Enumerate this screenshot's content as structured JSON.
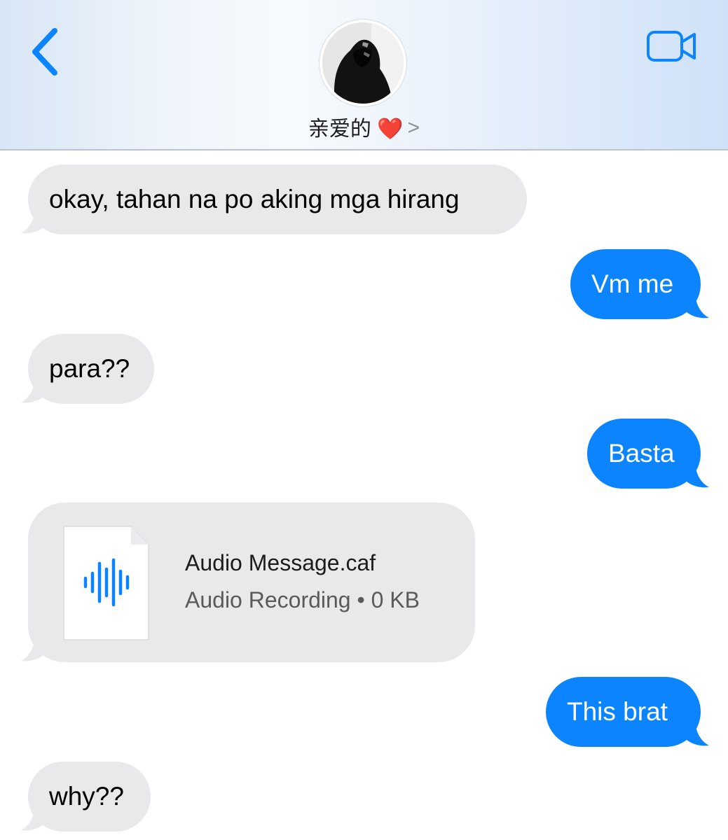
{
  "header": {
    "back_icon": "chevron-left-icon",
    "video_icon": "video-camera-icon",
    "contact_name": "亲爱的 ❤️",
    "chevron": ">"
  },
  "messages": [
    {
      "direction": "received",
      "text": "okay, tahan na po aking mga hirang"
    },
    {
      "direction": "sent",
      "text": "Vm me"
    },
    {
      "direction": "received",
      "text": "para??"
    },
    {
      "direction": "sent",
      "text": "Basta"
    },
    {
      "direction": "received",
      "attachment": {
        "icon": "audio-waveform-icon",
        "title": "Audio Message.caf",
        "subtitle": "Audio Recording • 0 KB"
      }
    },
    {
      "direction": "sent",
      "text": "This brat"
    },
    {
      "direction": "received",
      "text": "why??"
    }
  ],
  "colors": {
    "accent": "#0b84fe",
    "received_bubble": "#e9e9eb",
    "sent_text": "#ffffff"
  }
}
